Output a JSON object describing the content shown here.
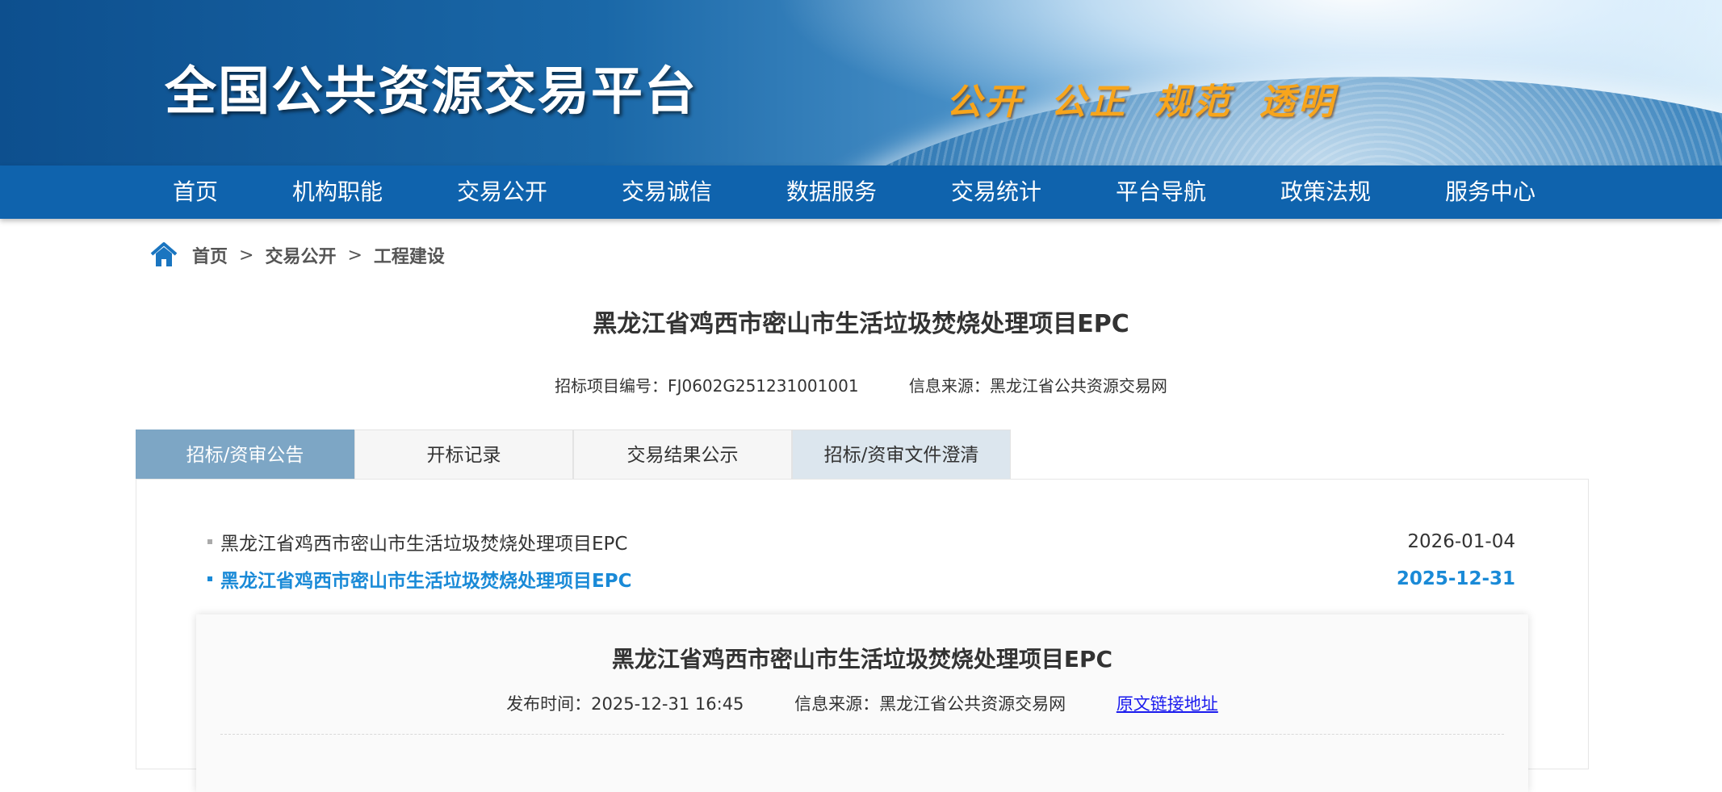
{
  "banner": {
    "site_name": "全国公共资源交易平台",
    "slogan": "公开 公正 规范 透明"
  },
  "nav": {
    "items": [
      "首页",
      "机构职能",
      "交易公开",
      "交易诚信",
      "数据服务",
      "交易统计",
      "平台导航",
      "政策法规",
      "服务中心"
    ]
  },
  "breadcrumb": {
    "items": [
      "首页",
      "交易公开",
      "工程建设"
    ],
    "separator": ">"
  },
  "project": {
    "title": "黑龙江省鸡西市密山市生活垃圾焚烧处理项目EPC",
    "code_label": "招标项目编号：FJ0602G251231001001",
    "source_label": "信息来源：黑龙江省公共资源交易网"
  },
  "tabs": [
    "招标/资审公告",
    "开标记录",
    "交易结果公示",
    "招标/资审文件澄清"
  ],
  "announcements": [
    {
      "title": "黑龙江省鸡西市密山市生活垃圾焚烧处理项目EPC",
      "date": "2026-01-04"
    },
    {
      "title": "黑龙江省鸡西市密山市生活垃圾焚烧处理项目EPC",
      "date": "2025-12-31"
    }
  ],
  "detail": {
    "title": "黑龙江省鸡西市密山市生活垃圾焚烧处理项目EPC",
    "publish_label": "发布时间：2025-12-31 16:45",
    "source_label": "信息来源：黑龙江省公共资源交易网",
    "link_text": "原文链接地址"
  },
  "colors": {
    "nav_bg": "#0f63ad",
    "active_tab": "#7da6c5",
    "active_link": "#1a8ad7",
    "slogan": "#f7a51c"
  }
}
